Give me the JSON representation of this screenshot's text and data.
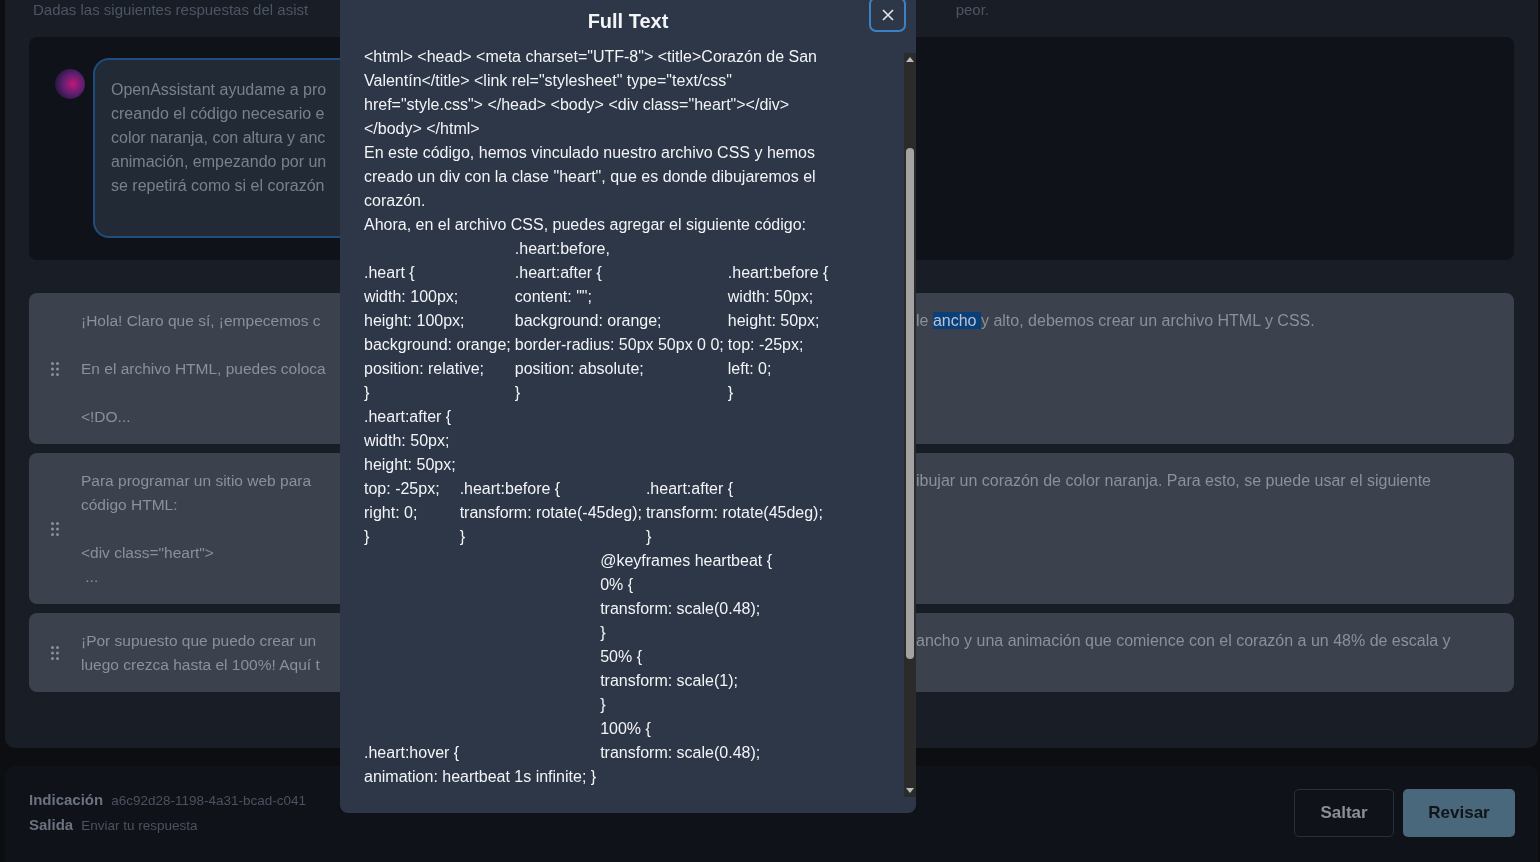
{
  "header": {
    "left": "Dadas las siguientes respuestas del asist",
    "right": "peor."
  },
  "prompt": {
    "text": "OpenAssistant ayudame a pro\ncreando el código necesario e\ncolor naranja, con altura y anc\nanimación, empezando por un\nse repetirá como si el corazón"
  },
  "responses": [
    {
      "left": "¡Hola! Claro que sí, ¡empecemos c\n\nEn el archivo HTML, puedes coloca\n\n<!DO...",
      "right_before": "le ",
      "right_highlight": "ancho ",
      "right_after": "y alto, debemos crear un archivo HTML y CSS."
    },
    {
      "left": "Para programar un sitio web para\ncódigo HTML:\n\n<div class=\"heart\">\n ...",
      "right_after": "ibujar un corazón de color naranja. Para esto, se puede usar el siguiente"
    },
    {
      "left": "¡Por supuesto que puedo crear un\nluego crezca hasta el 100%! Aquí t",
      "right_after": "ancho y una animación que comience con el corazón a un 48% de escala y"
    }
  ],
  "footer": {
    "prompt_label": "Indicación",
    "prompt_id": "a6c92d28-1198-4a31-bcad-c041",
    "output_label": "Salida",
    "output_hint": "Enviar tu respuesta"
  },
  "buttons": [
    {
      "label": "Saltar",
      "kind": "secondary"
    },
    {
      "label": "Revisar",
      "kind": "primary"
    }
  ],
  "modal": {
    "title": "Full Text",
    "blocks": [
      {
        "kind": "text",
        "text": "<html> <head> <meta charset=\"UTF-8\"> <title>Corazón de San Valentín</title> <link rel=\"stylesheet\" type=\"text/css\" href=\"style.css\"> </head> <body> <div class=\"heart\"></div> </body> </html>"
      },
      {
        "kind": "text",
        "text": "En este código, hemos vinculado nuestro archivo CSS y hemos creado un div con la clase \"heart\", que es donde dibujaremos el corazón."
      },
      {
        "kind": "text",
        "text": "Ahora, en el archivo CSS, puedes agregar el siguiente código:"
      },
      {
        "kind": "columns",
        "columns": [
          [
            ".heart {",
            "width: 100px;",
            "height: 100px;",
            "background: orange;",
            "position: relative;",
            "}"
          ],
          [
            ".heart:before,",
            ".heart:after {",
            "content: \"\";",
            "background: orange;",
            "border-radius: 50px 50px 0 0;",
            "position: absolute;",
            "}"
          ],
          [
            ".heart:before {",
            "width: 50px;",
            "height: 50px;",
            "top: -25px;",
            "left: 0;",
            "}"
          ]
        ]
      },
      {
        "kind": "columns",
        "columns": [
          [
            ".heart:after {",
            "width: 50px;",
            "height: 50px;",
            "top: -25px;",
            "right: 0;",
            "}"
          ],
          [
            ".heart:before {",
            "transform: rotate(-45deg);",
            "}"
          ],
          [
            ".heart:after {",
            "transform: rotate(45deg);",
            "}"
          ]
        ]
      },
      {
        "kind": "step",
        "columns": [
          [
            ".heart:hover {",
            "animation: heartbeat 1s infinite; }"
          ],
          [
            "@keyframes heartbeat {",
            "0% {",
            "transform: scale(0.48);",
            "}",
            "50% {",
            "transform: scale(1);",
            "}",
            "100% {",
            "transform: scale(0.48);"
          ]
        ]
      }
    ]
  }
}
